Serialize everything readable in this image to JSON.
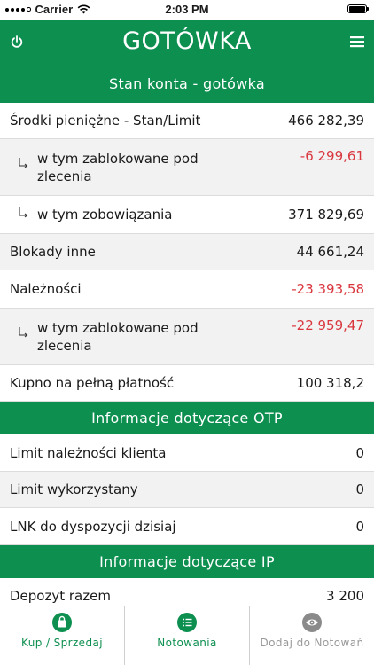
{
  "status_bar": {
    "carrier": "Carrier",
    "time": "2:03 PM"
  },
  "header": {
    "title": "GOTÓWKA"
  },
  "icons": {
    "power": "power-icon",
    "menu": "hamburger-menu-icon",
    "indent": "sub-item-arrow-icon",
    "buy_sell": "shopping-bag-icon",
    "quotes": "list-icon",
    "add_to_quotes": "eye-icon"
  },
  "colors": {
    "brand_green": "#0d8f50",
    "negative_red": "#d9363e",
    "row_gray": "#f2f2f2",
    "disabled_gray": "#999999"
  },
  "sections": {
    "account": {
      "title": "Stan konta - gotówka",
      "rows": [
        {
          "label": "Środki pieniężne - Stan/Limit",
          "value": "466 282,39"
        },
        {
          "label": "w tym zablokowane pod zlecenia",
          "value": "-6 299,61"
        },
        {
          "label": "w tym zobowiązania",
          "value": "371 829,69"
        },
        {
          "label": "Blokady inne",
          "value": "44 661,24"
        },
        {
          "label": "Należności",
          "value": "-23 393,58"
        },
        {
          "label": "w tym zablokowane pod zlecenia",
          "value": "-22 959,47"
        },
        {
          "label": "Kupno na pełną płatność",
          "value": "100 318,2"
        }
      ]
    },
    "otp": {
      "title": "Informacje dotyczące OTP",
      "rows": [
        {
          "label": "Limit należności klienta",
          "value": "0"
        },
        {
          "label": "Limit wykorzystany",
          "value": "0"
        },
        {
          "label": "LNK do dyspozycji dzisiaj",
          "value": "0"
        }
      ]
    },
    "ip": {
      "title": "Informacje dotyczące IP",
      "rows": [
        {
          "label": "Depozyt razem",
          "value": "3 200"
        }
      ]
    }
  },
  "bottom_bar": {
    "buy_sell": "Kup / Sprzedaj",
    "quotes": "Notowania",
    "add_to_quotes": "Dodaj do Notowań"
  }
}
